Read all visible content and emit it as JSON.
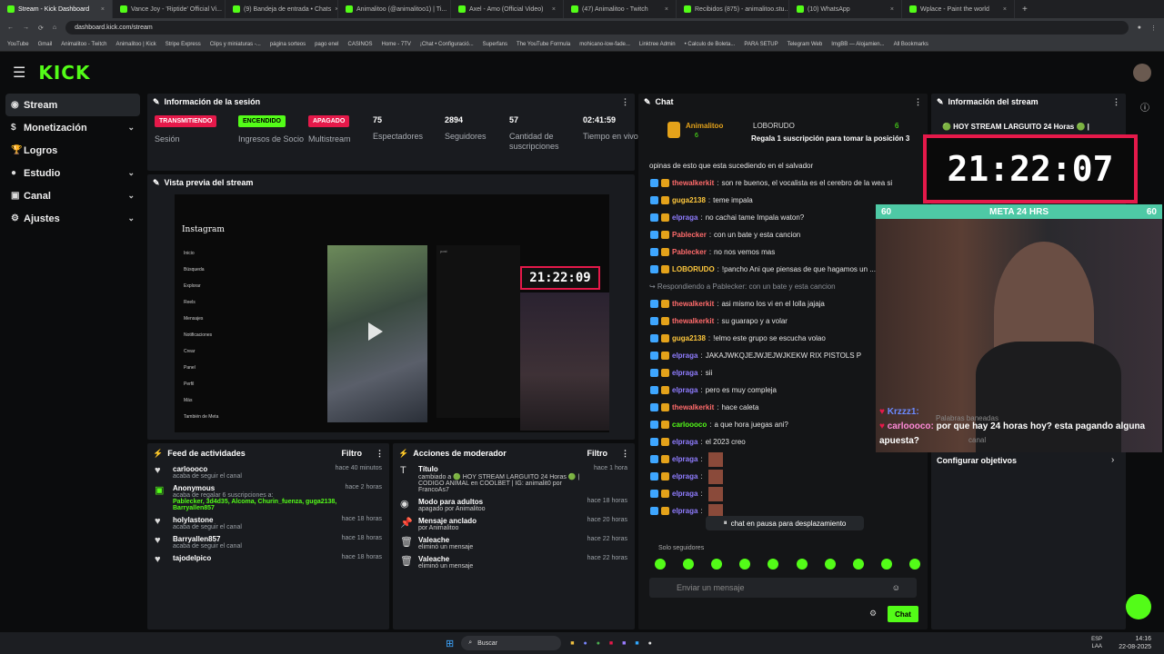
{
  "browser": {
    "tabs": [
      {
        "title": "Stream - Kick Dashboard"
      },
      {
        "title": "Vance Joy - 'Riptide' Official Vi..."
      },
      {
        "title": "(9) Bandeja de entrada • Chats"
      },
      {
        "title": "Animalitoo (@animalitoo1) | Ti..."
      },
      {
        "title": "Axel - Amo (Official Video)"
      },
      {
        "title": "(47) Animalitoo - Twitch"
      },
      {
        "title": "Recibidos (875) - animalitoo.stu..."
      },
      {
        "title": "(10) WhatsApp"
      },
      {
        "title": "Wplace - Paint the world"
      }
    ],
    "url": "dashboard.kick.com/stream",
    "bookmarks": [
      "YouTube",
      "Gmail",
      "Animalitoo - Twitch",
      "Animalitoo | Kick",
      "Stripe Express",
      "Clips y miniaturas -...",
      "página sorteos",
      "pago enel",
      "CASINOS",
      "Home - 7TV",
      "¡Chat • Configuració...",
      "Superfans",
      "The YouTube Formula",
      "mohicano-low-fade...",
      "Linktree Admin",
      "• Calculo de Boleta...",
      "PARA SETUP",
      "Telegram Web",
      "ImgBB — Alojamien...",
      "All Bookmarks"
    ]
  },
  "nav": [
    {
      "label": "Stream",
      "icon": "◉"
    },
    {
      "label": "Monetización",
      "icon": "$",
      "chev": "⌄"
    },
    {
      "label": "Logros",
      "icon": "🏆"
    },
    {
      "label": "Estudio",
      "icon": "●",
      "chev": "⌄"
    },
    {
      "label": "Canal",
      "icon": "▣",
      "chev": "⌄"
    },
    {
      "label": "Ajustes",
      "icon": "⚙",
      "chev": "⌄"
    }
  ],
  "session": {
    "title": "Información de la sesión",
    "badges": [
      {
        "text": "TRANSMITIENDO",
        "label": "Sesión",
        "bg": "#e5194a",
        "fg": "#fff"
      },
      {
        "text": "ENCENDIDO",
        "label": "Ingresos de Socio",
        "bg": "#53fc18",
        "fg": "#000"
      },
      {
        "text": "APAGADO",
        "label": "Multistream",
        "bg": "#e5194a",
        "fg": "#fff"
      }
    ],
    "stats": [
      {
        "value": "75",
        "label": "Espectadores"
      },
      {
        "value": "2894",
        "label": "Seguidores"
      },
      {
        "value": "57",
        "label": "Cantidad de suscripciones"
      },
      {
        "value": "02:41:59",
        "label": "Tiempo en vivo"
      }
    ]
  },
  "preview": {
    "title": "Vista previa del stream",
    "timer": "21:22:09",
    "insta": "Instagram",
    "menu": [
      "Inicio",
      "Búsqueda",
      "Explorar",
      "Reels",
      "Mensajes",
      "Notificaciones",
      "Crear",
      "Panel",
      "Perfil",
      "Más",
      "También de Meta"
    ]
  },
  "feed": {
    "title": "Feed de actividades",
    "filter": "Filtro",
    "items": [
      {
        "name": "carloooco",
        "time": "hace 40 minutos",
        "sub": "acaba de seguir el canal"
      },
      {
        "name": "Anonymous",
        "time": "hace 2 horas",
        "sub": "acaba de regalar 6 suscripciones a:",
        "extra": "Pablecker, 3d4d35, Alcoma, Churin_fuenza, guga2138, Barryallen857"
      },
      {
        "name": "holylastone",
        "time": "hace 18 horas",
        "sub": "acaba de seguir el canal"
      },
      {
        "name": "Barryallen857",
        "time": "hace 18 horas",
        "sub": "acaba de seguir el canal"
      },
      {
        "name": "tajodelpico",
        "time": "hace 18 horas",
        "sub": ""
      }
    ]
  },
  "mod": {
    "title": "Acciones de moderador",
    "filter": "Filtro",
    "items": [
      {
        "name": "Título",
        "time": "hace 1 hora",
        "sub": "cambiado a 🟢 HOY STREAM LARGUITO 24 Horas 🟢 | CODIGO ANIMAL en COOLBET | IG: animalit0 por FrancoAs7",
        "icon": "T"
      },
      {
        "name": "Modo para adultos",
        "time": "hace 18 horas",
        "sub": "apagado por Animalitoo",
        "icon": "◉"
      },
      {
        "name": "Mensaje anclado",
        "time": "hace 20 horas",
        "sub": "por Animalitoo",
        "icon": "📌"
      },
      {
        "name": "Valeache",
        "time": "hace 22 horas",
        "sub": "eliminó un mensaje",
        "icon": "🗑"
      },
      {
        "name": "Valeache",
        "time": "hace 22 horas",
        "sub": "eliminó un mensaje",
        "icon": "🗑"
      }
    ]
  },
  "chat": {
    "title": "Chat",
    "pinned": {
      "user": "Animalitoo",
      "count": "6",
      "user2": "LOBORUDO",
      "count2": "6",
      "msg": "Regala 1 suscripción para tomar la posición 3"
    },
    "lines": [
      {
        "user": "",
        "text": "opinas de esto que esta sucediendo en el salvador",
        "color": "#e4e4e4"
      },
      {
        "user": "thewalkerkit",
        "text": "son re buenos, el vocalista es el cerebro de la wea si",
        "color": "#ff6b6b"
      },
      {
        "user": "guga2138",
        "text": "teme impala",
        "color": "#ffc83d"
      },
      {
        "user": "elpraga",
        "text": "no cachai tame Impala waton?",
        "color": "#8f7cff"
      },
      {
        "user": "Pablecker",
        "text": "con un bate y esta cancion",
        "color": "#ff6b6b"
      },
      {
        "user": "Pablecker",
        "text": "no nos vemos mas",
        "color": "#ff6b6b"
      },
      {
        "user": "LOBORUDO",
        "text": "!pancho Ani que piensas de que hagamos un ... con el Praga , se va a Llamar Rixs pistols o algo asi , la parte del R... si",
        "color": "#ffc83d"
      },
      {
        "user": "",
        "text": "↪ Respondiendo a Pablecker: con un bate y esta cancion",
        "color": "#8a8f96"
      },
      {
        "user": "thewalkerkit",
        "text": "asi mismo los vi en el lolla jajaja",
        "color": "#ff6b6b"
      },
      {
        "user": "thewalkerkit",
        "text": "su guarapo y a volar",
        "color": "#ff6b6b"
      },
      {
        "user": "guga2138",
        "text": "!elmo este grupo se escucha volao",
        "color": "#ffc83d"
      },
      {
        "user": "elpraga",
        "text": "JAKAJWKQJEJWJEJWJKEKW RIX PISTOLS P",
        "color": "#8f7cff"
      },
      {
        "user": "elpraga",
        "text": "sii",
        "color": "#8f7cff"
      },
      {
        "user": "elpraga",
        "text": "pero es muy compleja",
        "color": "#8f7cff"
      },
      {
        "user": "thewalkerkit",
        "text": "hace caleta",
        "color": "#ff6b6b"
      },
      {
        "user": "carloooco",
        "text": "a que hora juegas ani?",
        "color": "#53fc18"
      },
      {
        "user": "elpraga",
        "text": "el 2023 creo",
        "color": "#8f7cff"
      },
      {
        "user": "elpraga",
        "text": "",
        "color": "#8f7cff"
      },
      {
        "user": "elpraga",
        "text": "",
        "color": "#8f7cff"
      },
      {
        "user": "elpraga",
        "text": "",
        "color": "#8f7cff"
      },
      {
        "user": "elpraga",
        "text": "",
        "color": "#8f7cff"
      }
    ],
    "paused": "chat en pausa para desplazamiento",
    "followers_only": "Solo seguidores",
    "input_placeholder": "Enviar un mensaje",
    "send": "Chat"
  },
  "info": {
    "title": "Información del stream",
    "stream_title": "🟢 HOY STREAM LARGUITO 24 Horas 🟢 |",
    "clock": "21:22:07",
    "goal": {
      "left": "60",
      "label": "META 24 HRS",
      "right": "60"
    },
    "overlay_user": "Krzzz1:",
    "overlay_user2": "carloooco:",
    "overlay_msg": "por que hay 24 horas hoy? esta pagando alguna apuesta?",
    "words": "Palabras baneadas",
    "canal": "canal",
    "config": "Configurar objetivos"
  },
  "taskbar": {
    "search": "Buscar",
    "lang": "ESP\nLAA",
    "time": "14:16",
    "date": "22-08-2025"
  }
}
